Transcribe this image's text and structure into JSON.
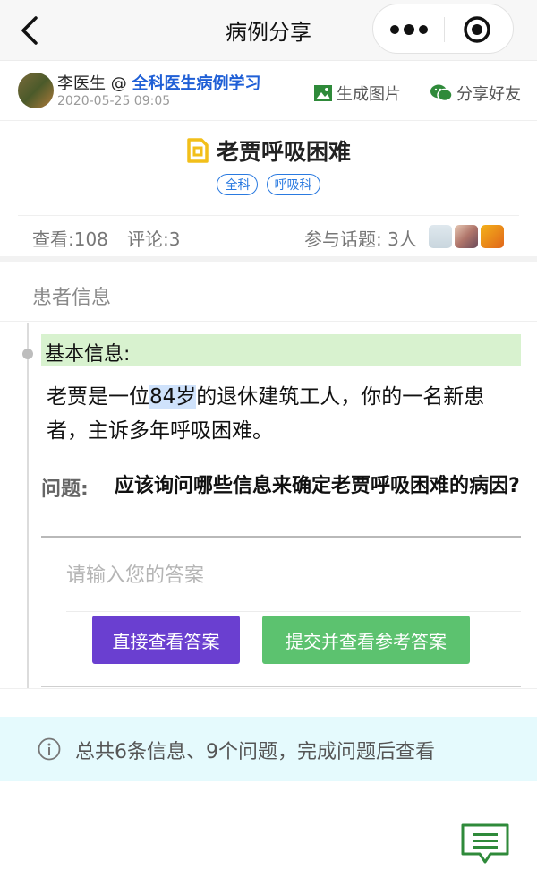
{
  "nav": {
    "title": "病例分享"
  },
  "author": {
    "name_prefix": "李医生 @ ",
    "group": "全科医生病例学习",
    "time": "2020-05-25 09:05",
    "generate_image": "生成图片",
    "share_friends": "分享好友"
  },
  "case": {
    "title": "老贾呼吸困难",
    "tags": [
      "全科",
      "呼吸科"
    ]
  },
  "stats": {
    "views": "查看:108",
    "comments": "评论:3",
    "participants": "参与话题: 3人"
  },
  "section": {
    "label": "患者信息"
  },
  "info": {
    "heading": "基本信息:",
    "body_before": "老贾是一位",
    "body_highlight": "84岁",
    "body_after": "的退休建筑工人，你的一名新患者，主诉多年呼吸困难。"
  },
  "question": {
    "label": "问题:",
    "text": "应该询问哪些信息来确定老贾呼吸困难的病因?"
  },
  "answer": {
    "placeholder": "请输入您的答案",
    "value": ""
  },
  "buttons": {
    "direct": "直接查看答案",
    "submit": "提交并查看参考答案"
  },
  "notice": {
    "text": "总共6条信息、9个问题，完成问题后查看"
  },
  "colors": {
    "accent_blue": "#1f5fd6",
    "direct_button": "#6a3fd0",
    "submit_button": "#5cc26f",
    "info_highlight": "#d8f2cf",
    "notice_bg": "#e5fafd",
    "comment_icon": "#2f8a3a"
  },
  "icons": [
    "back-arrow-icon",
    "more-dots-icon",
    "target-icon",
    "image-icon",
    "wechat-icon",
    "document-icon",
    "info-icon",
    "comment-icon"
  ]
}
